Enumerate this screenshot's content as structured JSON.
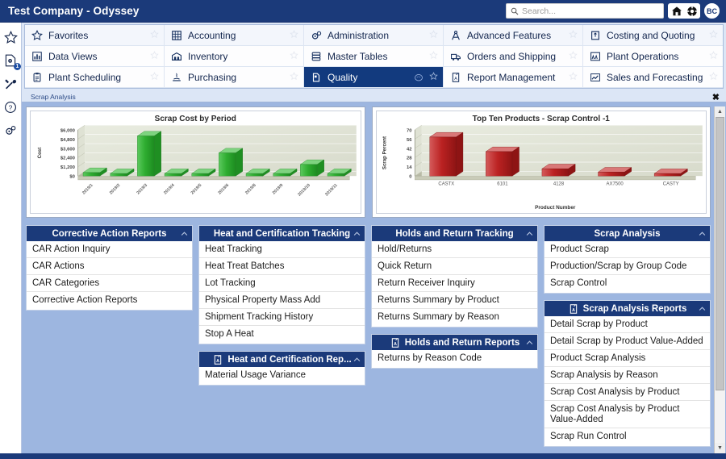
{
  "titlebar": {
    "title": "Test Company - Odyssey",
    "search_placeholder": "Search...",
    "home_icon": "home-icon",
    "support_icon": "lifebuoy-icon",
    "avatar_initials": "BC"
  },
  "rail": {
    "items": [
      {
        "icon": "star-icon",
        "name": "favorites"
      },
      {
        "icon": "document-gear-icon",
        "name": "notifications",
        "badge": "1"
      },
      {
        "icon": "tools-icon",
        "name": "tools"
      },
      {
        "icon": "help-icon",
        "name": "help"
      },
      {
        "icon": "gears-icon",
        "name": "settings"
      }
    ]
  },
  "modules": [
    {
      "label": "Favorites",
      "icon": "star-icon",
      "active": false,
      "row": 1
    },
    {
      "label": "Accounting",
      "icon": "accounting-grid-icon",
      "active": false,
      "row": 1
    },
    {
      "label": "Administration",
      "icon": "admin-gears-icon",
      "active": false,
      "row": 1
    },
    {
      "label": "Advanced Features",
      "icon": "compass-icon",
      "active": false,
      "row": 1
    },
    {
      "label": "Costing and Quoting",
      "icon": "costing-icon",
      "active": false,
      "row": 1
    },
    {
      "label": "Data Views",
      "icon": "bar-chart-icon",
      "active": false,
      "row": 2
    },
    {
      "label": "Inventory",
      "icon": "warehouse-icon",
      "active": false,
      "row": 2
    },
    {
      "label": "Master Tables",
      "icon": "database-icon",
      "active": false,
      "row": 2
    },
    {
      "label": "Orders and Shipping",
      "icon": "truck-icon",
      "active": false,
      "row": 2
    },
    {
      "label": "Plant Operations",
      "icon": "factory-icon",
      "active": false,
      "row": 2
    },
    {
      "label": "Plant Scheduling",
      "icon": "clipboard-icon",
      "active": false,
      "row": 3
    },
    {
      "label": "Purchasing",
      "icon": "purchasing-icon",
      "active": false,
      "row": 3
    },
    {
      "label": "Quality",
      "icon": "quality-icon",
      "active": true,
      "row": 3
    },
    {
      "label": "Report Management",
      "icon": "report-pdf-icon",
      "active": false,
      "row": 3
    },
    {
      "label": "Sales and Forecasting",
      "icon": "trend-chart-icon",
      "active": false,
      "row": 3
    }
  ],
  "tabs": {
    "items": [
      {
        "label": "Scrap Analysis",
        "active": true
      }
    ],
    "close_label": "✖"
  },
  "chart_data": [
    {
      "type": "bar",
      "title": "Scrap Cost by Period",
      "xlabel": "",
      "ylabel": "Cost",
      "categories": [
        "2019/1",
        "2019/2",
        "2019/3",
        "2019/4",
        "2019/5",
        "2019/6",
        "2019/8",
        "2019/9",
        "2019/10",
        "2019/11"
      ],
      "values": [
        450,
        20,
        5200,
        60,
        20,
        3000,
        20,
        20,
        1500,
        20
      ],
      "ytick_labels": [
        "$0",
        "$1,200",
        "$2,400",
        "$3,600",
        "$4,800",
        "$6,000"
      ],
      "ytick_values": [
        0,
        1200,
        2400,
        3600,
        4800,
        6000
      ],
      "ylim": [
        0,
        6000
      ],
      "grid": true,
      "legend": "none",
      "bar_color": "#2fad31"
    },
    {
      "type": "bar",
      "title": "Top Ten Products - Scrap Control -1",
      "xlabel": "Product Number",
      "ylabel": "Scrap Percent",
      "categories": [
        "CASTX",
        "6101",
        "4128",
        "AX7500",
        "CASTY"
      ],
      "values": [
        59,
        37,
        11,
        6,
        1
      ],
      "ytick_labels": [
        "0",
        "14",
        "28",
        "42",
        "56",
        "70"
      ],
      "ytick_values": [
        0,
        14,
        28,
        42,
        56,
        70
      ],
      "ylim": [
        0,
        70
      ],
      "grid": true,
      "legend": "none",
      "bar_color": "#bb2222"
    }
  ],
  "columns": [
    {
      "panels": [
        {
          "title": "Corrective Action Reports",
          "icon": null,
          "collapse_icon": "chevron-up-icon",
          "items": [
            "CAR Action Inquiry",
            "CAR Actions",
            "CAR Categories",
            "Corrective Action Reports"
          ]
        }
      ]
    },
    {
      "panels": [
        {
          "title": "Heat and Certification Tracking",
          "icon": null,
          "collapse_icon": "chevron-up-icon",
          "items": [
            "Heat Tracking",
            "Heat Treat Batches",
            "Lot Tracking",
            "Physical Property Mass Add",
            "Shipment Tracking History",
            "Stop A Heat"
          ]
        },
        {
          "title": "Heat and Certification Rep...",
          "icon": "report-pdf-icon",
          "collapse_icon": "chevron-up-icon",
          "items": [
            "Material Usage Variance"
          ]
        }
      ]
    },
    {
      "panels": [
        {
          "title": "Holds and Return Tracking",
          "icon": null,
          "collapse_icon": "chevron-up-icon",
          "items": [
            "Hold/Returns",
            "Quick Return",
            "Return Receiver Inquiry",
            "Returns Summary by Product",
            "Returns Summary by Reason"
          ]
        },
        {
          "title": "Holds and Return Reports",
          "icon": "report-pdf-icon",
          "collapse_icon": "chevron-up-icon",
          "items": [
            "Returns by Reason Code"
          ]
        }
      ]
    },
    {
      "panels": [
        {
          "title": "Scrap Analysis",
          "icon": null,
          "collapse_icon": "chevron-up-icon",
          "items": [
            "Product Scrap",
            "Production/Scrap by Group Code",
            "Scrap Control"
          ]
        },
        {
          "title": "Scrap Analysis Reports",
          "icon": "report-pdf-icon",
          "collapse_icon": "chevron-up-icon",
          "items": [
            "Detail Scrap by Product",
            "Detail Scrap by Product Value-Added",
            "Product Scrap Analysis",
            "Scrap Analysis by Reason",
            "Scrap Cost Analysis by Product",
            "Scrap Cost Analysis by Product Value-Added",
            "Scrap Run Control"
          ]
        }
      ]
    }
  ],
  "scrollbar": {
    "up_arrow": "▲",
    "down_arrow": "▼"
  },
  "colors": {
    "brand_navy": "#1b3a7a",
    "dash_blue": "#9db6e0",
    "green_bar": "#2fad31",
    "red_bar": "#bb2222"
  }
}
